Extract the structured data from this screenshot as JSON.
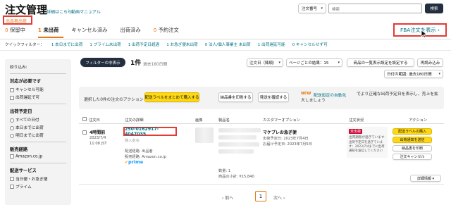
{
  "header": {
    "title": "注文管理",
    "help_link": "詳細はこちら",
    "video_link": "動画マニュアル",
    "search_type": "注文番号",
    "search_placeholder": "検索",
    "search_button": "検索"
  },
  "shipping_link": "出品者出荷",
  "fba_link": "FBA注文を表示 ›",
  "tabs": [
    {
      "count": "0",
      "label": "保留中"
    },
    {
      "count": "1",
      "label": "未出荷"
    },
    {
      "count": "",
      "label": "キャンセル済み"
    },
    {
      "count": "",
      "label": "出荷済み"
    },
    {
      "count": "0",
      "label": "予約注文"
    }
  ],
  "quick_filter": {
    "label": "クイックフィルター：",
    "items": [
      "1 本日までに出荷",
      "1 プライム未出荷",
      "1 出荷予定日超過",
      "1 お急ぎ便未出荷",
      "0 法人/個人事業主 未出荷",
      "1 出荷遅延可能",
      "0 キャンセルせず可"
    ]
  },
  "sidebar": {
    "title": "絞り込み:",
    "sections": [
      {
        "heading": "対応が必要です",
        "type": "checkbox",
        "items": [
          "キャンセル可能",
          "出荷遅延で可"
        ]
      },
      {
        "heading": "出荷予定日",
        "type": "radio",
        "items": [
          "すべての日付",
          "本日までに出荷",
          "明日までに出荷"
        ]
      },
      {
        "heading": "販売経路",
        "type": "checkbox",
        "items": [
          "Amazon.co.jp"
        ]
      },
      {
        "heading": "配送サービス",
        "type": "checkbox",
        "items": [
          "当日便・お急ぎ便",
          "プライム"
        ]
      }
    ]
  },
  "toolbar": {
    "filter_button": "フィルターの非表示",
    "count": "1件",
    "period": "過去180日間",
    "sort_select": "注文日（降順）",
    "page_results": "ページごとの結果：15",
    "search_settings": "商品の一覧表示設定を設定する",
    "refresh": "再読み込み",
    "date_range": "日付の範囲: 過去180日間"
  },
  "action_bar": {
    "selected": "選択した0件の注文のアクション",
    "print_labels": "配送ラベルをまとめて購入する",
    "print_slip": "納品書を印刷する",
    "confirm_ship": "発送を確認する",
    "new_badge": "NEW",
    "auto_link": "配送設定の自動化",
    "promo_text": "でより正確な出荷予定日を表示し、売上を拡大しましょう"
  },
  "table": {
    "columns": [
      "注文日",
      "注文の詳細",
      "画像",
      "製品名",
      "カスタマーオプション",
      "注文状況",
      "アクション"
    ],
    "row": {
      "time_ago": "4時間前",
      "date": "2023/7/4",
      "time": "11:08 JST",
      "order_id": "250-0162917-4047035",
      "buyer_label": "購入者名:",
      "channel_label": "配送経路:",
      "channel_value": "出品者",
      "sales_label": "販売経路:",
      "sales_value": "Amazon.co.jp",
      "prime": "prime",
      "quantity": "数量: 1",
      "subtotal": "商品の小計: ¥15,840",
      "option_title": "マケプレお急ぎ便",
      "ship_by": "出荷予定日: 2023年7月4日",
      "deliver_by": "お届け予定日: 2023年7月5日",
      "status_badge": "未出荷",
      "status_text": "出荷期限が過ぎています",
      "status_note": "出荷予定日を過ぎています：2023/7/4までに出荷通知を送信してください",
      "actions": [
        "配送ラベルの購入",
        "出荷通知を送信",
        "納品書を印刷",
        "注文キャンセル"
      ],
      "details": "詳細情報 ▾"
    }
  },
  "pagination": {
    "prev": "‹ 前へ",
    "page": "1",
    "next": "次へ ›"
  }
}
